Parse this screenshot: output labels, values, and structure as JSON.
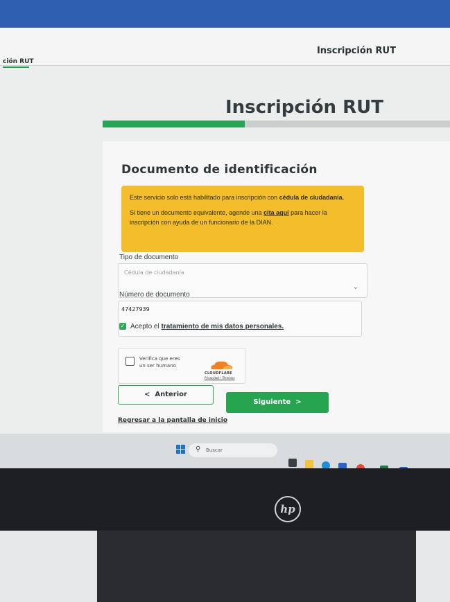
{
  "header": {
    "right_title": "Inscripción RUT",
    "left_crumb": "ción RUT"
  },
  "page": {
    "title": "Inscripción RUT",
    "progress_fraction": 0.41
  },
  "form": {
    "section_title": "Documento de identificación",
    "notice": {
      "line1_prefix": "Este servicio solo está habilitado para inscripción con ",
      "line1_bold": "cédula de ciudadanía.",
      "line2_prefix": "Si tiene un documento equivalente, agende una ",
      "line2_link": "cita aquí",
      "line2_suffix": " para hacer la inscripción con ayuda de un funcionario de la DIAN."
    },
    "doc_type_label": "Tipo de documento",
    "doc_type_value": "Cédula de ciudadanía",
    "doc_number_label": "Número de documento",
    "doc_number_value": "47427939",
    "accept_prefix": "Acepto el ",
    "accept_link": "tratamiento de mis datos personales.",
    "captcha_text": "Verifica que eres un ser humano",
    "captcha_brand": "CLOUDFLARE",
    "captcha_links": "Privacidad • Términos",
    "prev_label": "Anterior",
    "next_label": "Siguiente",
    "back_link": "Regresar a la pantalla de inicio"
  },
  "taskbar": {
    "search_placeholder": "Buscar"
  },
  "colors": {
    "brand_green": "#26a450",
    "notice_yellow": "#f3be2a",
    "top_blue": "#2f5fb0"
  }
}
